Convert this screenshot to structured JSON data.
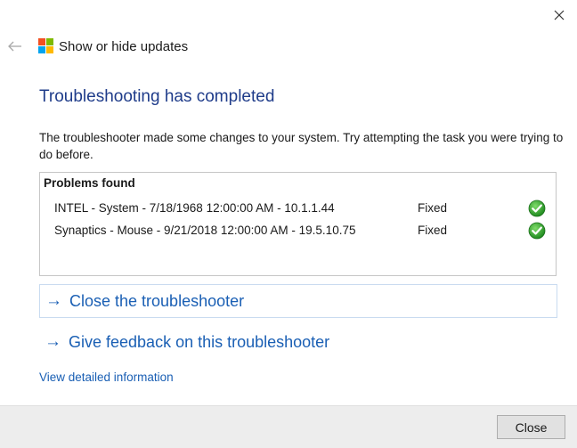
{
  "window": {
    "title": "Show or hide updates"
  },
  "main": {
    "heading": "Troubleshooting has completed",
    "description": "The troubleshooter made some changes to your system. Try attempting the task you were trying to do before."
  },
  "problems": {
    "header": "Problems found",
    "items": [
      {
        "name": "INTEL - System - 7/18/1968 12:00:00 AM - 10.1.1.44",
        "status": "Fixed",
        "icon": "check-icon"
      },
      {
        "name": "Synaptics - Mouse - 9/21/2018 12:00:00 AM - 19.5.10.75",
        "status": "Fixed",
        "icon": "check-icon"
      }
    ]
  },
  "actions": {
    "close_troubleshooter": "Close the troubleshooter",
    "give_feedback": "Give feedback on this troubleshooter",
    "view_details": "View detailed information"
  },
  "footer": {
    "close_label": "Close"
  },
  "colors": {
    "heading": "#1f3c8a",
    "link": "#1a5fb4",
    "success": "#2e9b2e"
  }
}
